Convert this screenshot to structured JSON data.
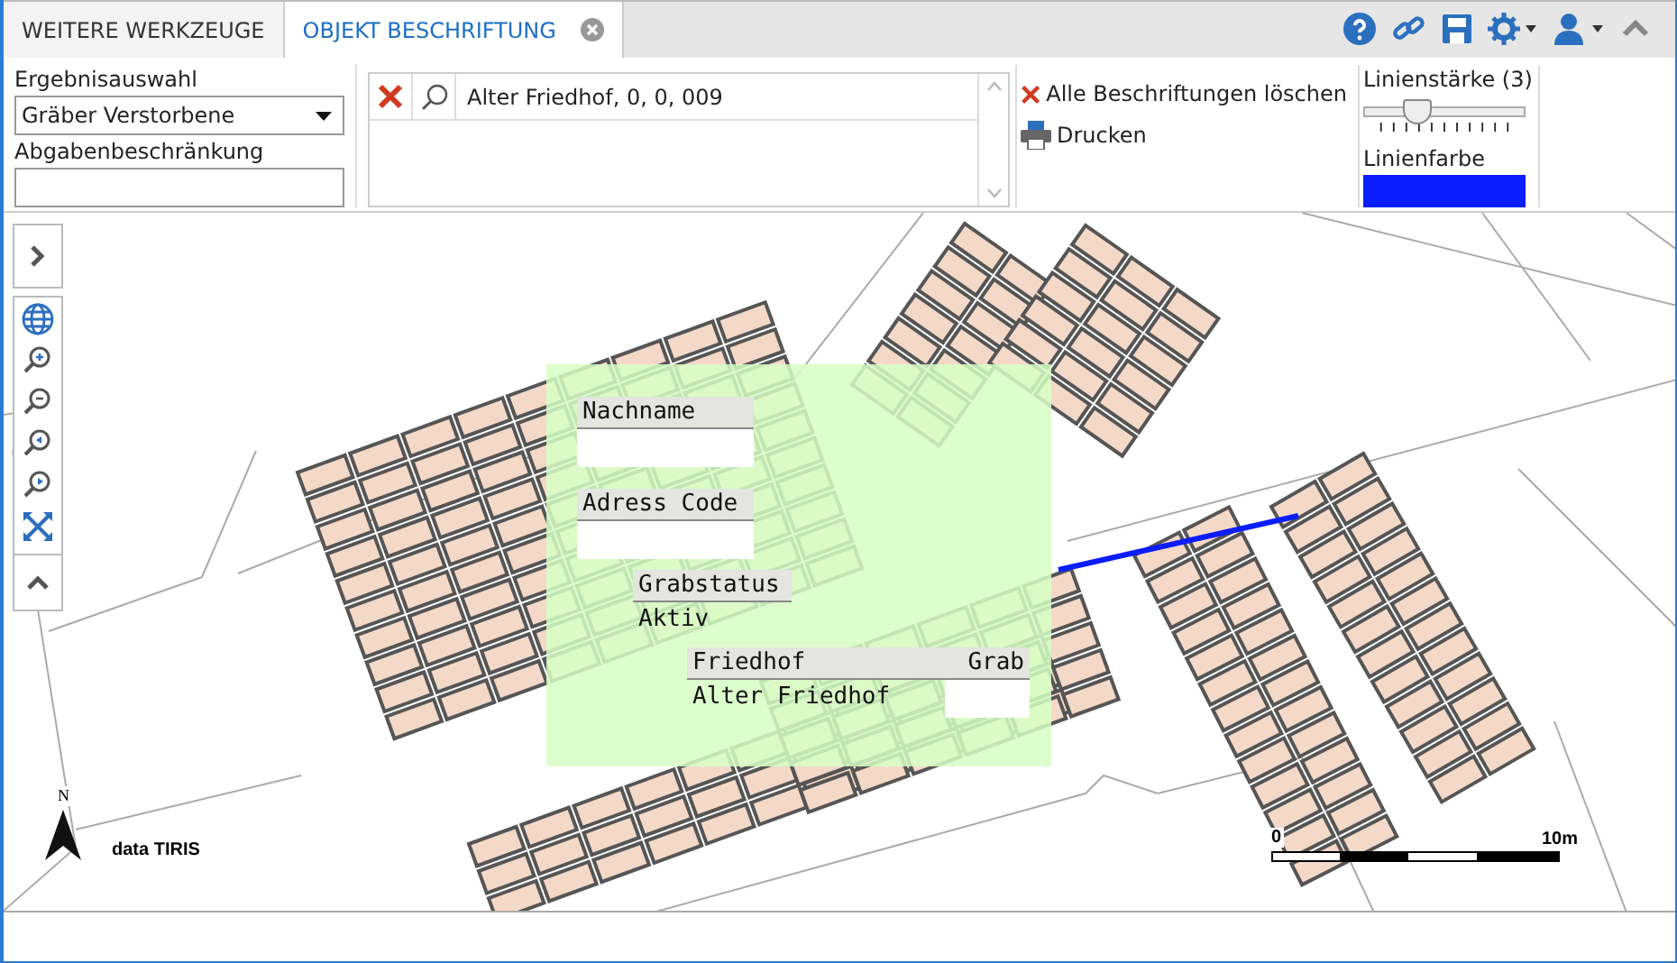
{
  "tabs": [
    {
      "label": "WEITERE WERKZEUGE",
      "selected": false,
      "closable": false
    },
    {
      "label": "OBJEKT BESCHRIFTUNG",
      "selected": true,
      "closable": true
    }
  ],
  "toolbar": {
    "result_selection": {
      "label": "Ergebnisauswahl",
      "value": "Gräber Verstorbene"
    },
    "restriction": {
      "label": "Abgabenbeschränkung"
    },
    "results": [
      {
        "text": "Alter Friedhof, 0, 0, 009"
      }
    ],
    "actions": [
      {
        "kind": "delete",
        "label": "Alle Beschriftungen löschen"
      },
      {
        "kind": "print",
        "label": "Drucken"
      }
    ],
    "line_width": {
      "label": "Linienstärke (3)",
      "level": 0.33
    },
    "line_color": {
      "label": "Linienfarbe",
      "color": "#0a1dfc"
    }
  },
  "map": {
    "label_panel": [
      {
        "kind": "empty",
        "header": "Nachname"
      },
      {
        "kind": "empty",
        "header": "Adress Code"
      },
      {
        "kind": "value",
        "header": "Grabstatus",
        "value": "Aktiv"
      },
      {
        "kind": "table",
        "headers": [
          "Friedhof",
          "Grab"
        ],
        "values": [
          "Alter Friedhof"
        ]
      }
    ],
    "north": "N",
    "attribution": "data TIRIS",
    "scale": {
      "start": "0",
      "end": "10m"
    }
  }
}
